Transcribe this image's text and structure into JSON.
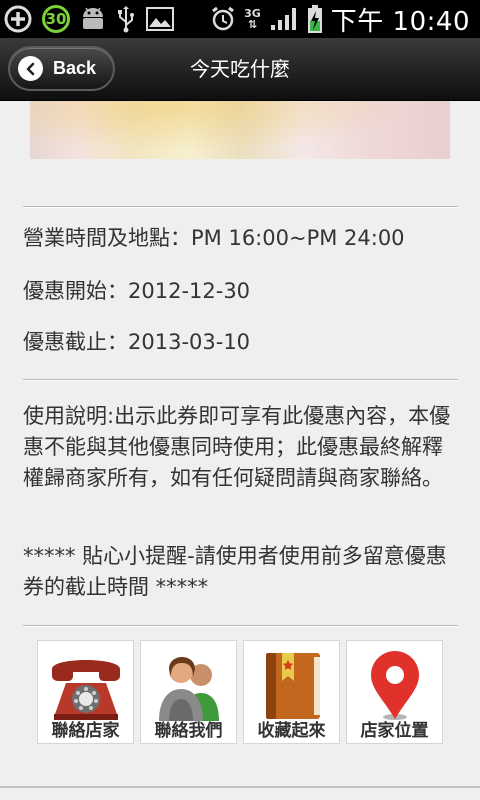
{
  "status_bar": {
    "badge": "30",
    "network": "3G",
    "time": "下午 10:40"
  },
  "header": {
    "back_label": "Back",
    "title": "今天吃什麼"
  },
  "info": {
    "hours": "營業時間及地點：PM 16:00~PM 24:00",
    "start": "優惠開始：2012-12-30",
    "end": "優惠截止：2013-03-10"
  },
  "description": {
    "usage": "使用說明:出示此券即可享有此優惠內容，本優惠不能與其他優惠同時使用；此優惠最終解釋權歸商家所有，如有任何疑問請與商家聯絡。",
    "reminder": "***** 貼心小提醒-請使用者使用前多留意優惠券的截止時間 *****"
  },
  "actions": [
    {
      "label": "聯絡店家",
      "icon": "telephone-icon"
    },
    {
      "label": "聯絡我們",
      "icon": "people-icon"
    },
    {
      "label": "收藏起來",
      "icon": "bookmark-book-icon"
    },
    {
      "label": "店家位置",
      "icon": "map-pin-icon"
    }
  ],
  "colors": {
    "status_bar_bg": "#000000",
    "title_bar_bg": "#1a1a1a",
    "page_bg": "#efefef",
    "text": "#333333",
    "pin_red": "#e0312a"
  }
}
